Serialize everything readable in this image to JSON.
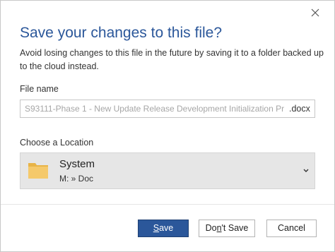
{
  "dialog": {
    "title": "Save your changes to this file?",
    "description": "Avoid losing changes to this file in the future by saving it to a folder backed up to the cloud instead.",
    "close_icon": "close-icon"
  },
  "file_name": {
    "label": "File name",
    "value": "S93111-Phase 1 - New Update Release Development Initialization Pr",
    "extension": ".docx"
  },
  "location": {
    "label": "Choose a Location",
    "icon": "folder-icon",
    "name": "System",
    "path": "M: » Doc",
    "dropdown_icon": "chevron-down-icon"
  },
  "buttons": {
    "save_mnemonic": "S",
    "save_rest": "ave",
    "dont_save_pre": "Do",
    "dont_save_mnemonic": "n",
    "dont_save_rest": "'t Save",
    "cancel": "Cancel"
  },
  "colors": {
    "accent": "#2b579a",
    "folder": "#f0c36d"
  }
}
